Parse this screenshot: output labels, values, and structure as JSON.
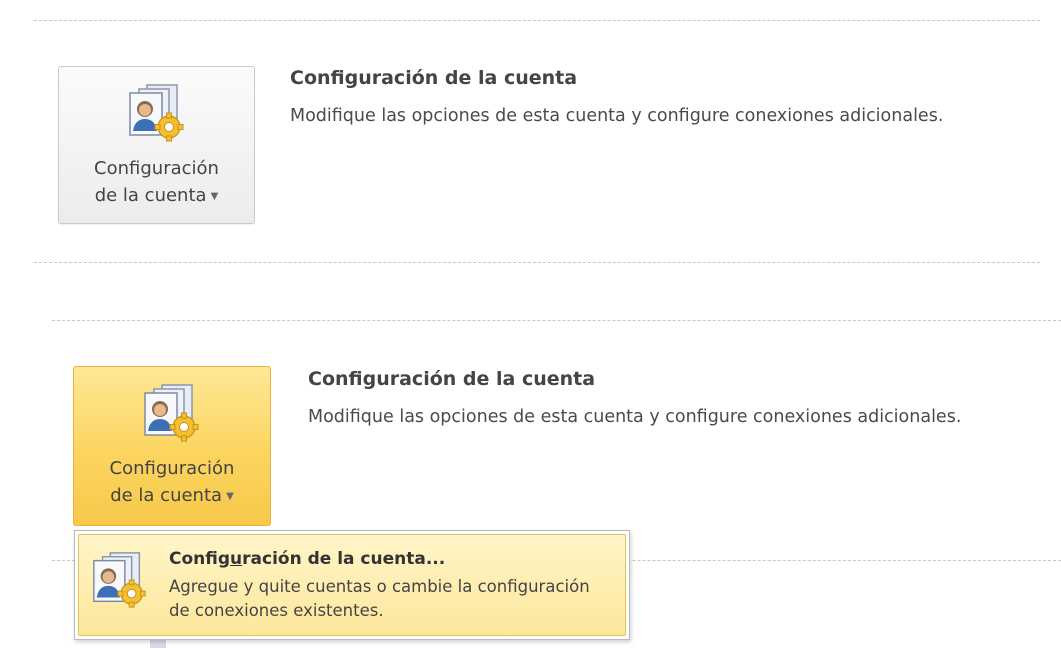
{
  "panel_top": {
    "button_label_line1": "Configuración",
    "button_label_line2": "de la cuenta",
    "title": "Configuración de la cuenta",
    "description": "Modifique las opciones de esta cuenta y configure conexiones adicionales."
  },
  "panel_bottom": {
    "button_label_line1": "Configuración",
    "button_label_line2": "de la cuenta",
    "title": "Configuración de la cuenta",
    "description": "Modifique las opciones de esta cuenta y configure conexiones adicionales."
  },
  "dropdown": {
    "item": {
      "title_before": "Config",
      "title_accel": "u",
      "title_after": "ración de la cuenta...",
      "description": "Agregue y quite cuentas o cambie la configuración de conexiones existentes."
    }
  },
  "icons": {
    "account_settings": "account-settings-icon",
    "caret": "chevron-down-icon"
  },
  "colors": {
    "hover_button": "#fbd55f",
    "dropdown_highlight": "#fde79a"
  }
}
